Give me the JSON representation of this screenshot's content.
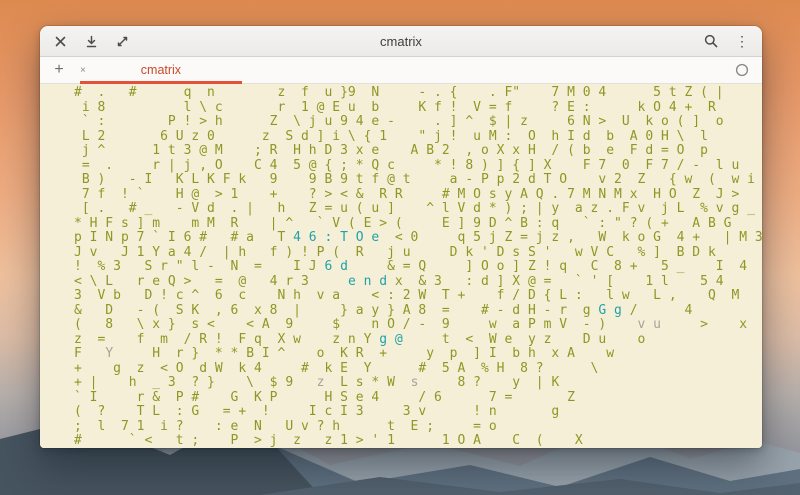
{
  "window": {
    "title": "cmatrix",
    "tab": {
      "label": "cmatrix"
    },
    "icons": {
      "titlebar_left": [
        "close-icon",
        "download-icon",
        "maximize-icon"
      ],
      "titlebar_right": [
        "search-icon",
        "menu-icon"
      ],
      "menu_glyph": "⋮",
      "new_tab_glyph": "+",
      "tab_close_glyph": "×"
    },
    "colors": {
      "tab_label": "#c8492b",
      "tab_accent": "#e55039"
    }
  },
  "terminal": {
    "colors": {
      "bg": "#f6efd8",
      "base": "#8f9724",
      "cyan": "#23a2a4",
      "gray": "#a4a49c"
    },
    "rows": [
      "#  .   #      q  n        z  f  u }9  N     - . {    . F\"    7 M 0 4      5 t Z ( |",
      " i 8          l \\ c       r  1 @ E u  b     K f !  V = f     ? E :      k O 4 +  R",
      " ` :        P ! > h      Z  \\ j u 9 4 e -     . ] ^  $ | z     6 N >  U  k o ( ]  o",
      " L 2       6 U z 0      z  S d ] i \\ { 1    \" j !  u M :  O  h I d  b  A 0 H \\  l",
      " j ^      1 t 3 @ M    ; R  H h D 3 x e    A B 2  , o X x H  / ( b  e  F d = O  p",
      " =  .     r | j , O    C 4  5 @ { ; * Q c     * ! 8 ) ] { ] X    F 7  0  F 7 / -  l u",
      " B )   - I   K L K F k   9    9 B 9 t f @ t     a - P p 2 d T O    v 2  Z   { w  (  w i",
      " 7 f  ! `    H @  > 1    +    ? > < &  R R     # M O s y A Q . 7 M N M x  H O  Z  J >",
      " [ .   # _   - V d  . |   h   Z = u ( u ]    ^ l V d * ) ; | y  a z . F v  j L  % v g _",
      "* H F s ] m    m M  R    | ^   ` V ( E > (     E ] 9 D ^ B : q   ` : \" ? ( +   A B G",
      [
        {
          "t": "p I N p 7 ` I 6 #   # a   T "
        },
        {
          "t": "4 6 : T O e",
          "c": "cyan"
        },
        {
          "t": "  < 0     q 5 j Z = j z ,   W  k o G  4 +   | M 3"
        }
      ],
      "J v   J 1 Y a 4 /  | h   f ) ! P (  R   j u     D k ' D s S '   w V C   % ]  B D k",
      [
        {
          "t": "!  % 3   S r \" l -  N  =    I J "
        },
        {
          "t": "6 d",
          "c": "cyan"
        },
        {
          "t": "     & = Q     ] O o ] Z ! q   C  8 +   5 _    I  4"
        }
      ],
      [
        {
          "t": "< \\ L   r e Q >   =  @   4 r 3     "
        },
        {
          "t": "e n d",
          "c": "cyan"
        },
        {
          "t": " x  & 3   : d ] X @ =   ` ' [    1 l    5 4"
        }
      ],
      "3  V b   D ! c ^  6  c    N h  v a    < : 2 W  T +    f / D { L :   l w   L ,    Q  M",
      [
        {
          "t": "&   D   - (  S K  , 6  x 8  |     } a y } A 8  =    # - d H - r  g "
        },
        {
          "t": "G g",
          "c": "cyan"
        },
        {
          "t": " /      4"
        }
      ],
      [
        {
          "t": "(   8   \\ x }  s <    < A  9     $    n O / -  9     w  a P m V  - )    "
        },
        {
          "t": "v u",
          "c": "gray"
        },
        {
          "t": "     >    x"
        }
      ],
      [
        {
          "t": "z  =    f  m  / R !  F q  X w    z n Y "
        },
        {
          "t": "g @",
          "c": "cyan"
        },
        {
          "t": "     t  <  W e  y z    D u    o"
        }
      ],
      [
        {
          "t": "F   "
        },
        {
          "t": "Y",
          "c": "gray"
        },
        {
          "t": "     H  r }  * * B I ^    o  K R  +     y  p  ] I  b h  x A    w"
        }
      ],
      "+    g  z  < O  d W  k 4     #  k E  Y      #  5 A  % H  8 ?      \\",
      [
        {
          "t": "+ |    h  _ 3  ? }    \\  $ 9   "
        },
        {
          "t": "z",
          "c": "gray"
        },
        {
          "t": "  L s * W  "
        },
        {
          "t": "s",
          "c": "gray"
        },
        {
          "t": "     8 ?    y  | K"
        }
      ],
      "` I     r &  P #    G  K P      H S e 4     / 6      7 =       Z",
      "(  ?    T L  : G   = +  !     I c I 3     3 v      ! n       g",
      ";  l  7 1  i ?    : e  N   U v ? h      t  E ;     = o",
      "#      ` <   t ;    P  > j  z   z 1 > ' 1      1 O A    C  (    X"
    ]
  }
}
